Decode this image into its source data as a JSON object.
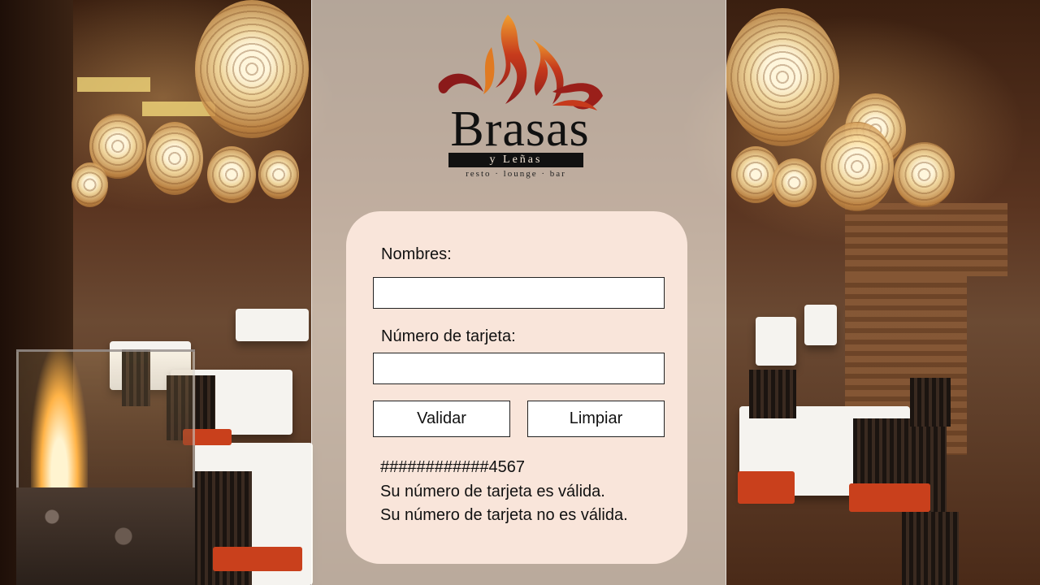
{
  "brand": {
    "name": "Brasas",
    "subtitle": "y Leñas",
    "tagline": "resto · lounge · bar"
  },
  "form": {
    "name_label": "Nombres:",
    "name_value": "",
    "card_label": "Número de tarjeta:",
    "card_value": "",
    "validate_button": "Validar",
    "clear_button": "Limpiar"
  },
  "results": {
    "masked_number": "############4567",
    "valid_message": "Su número de tarjeta es válida.",
    "invalid_message": "Su número de tarjeta no es válida."
  },
  "colors": {
    "card_background": "#f9e5da",
    "logo_flame_red": "#8b1a1a",
    "logo_flame_orange": "#e8891c"
  }
}
